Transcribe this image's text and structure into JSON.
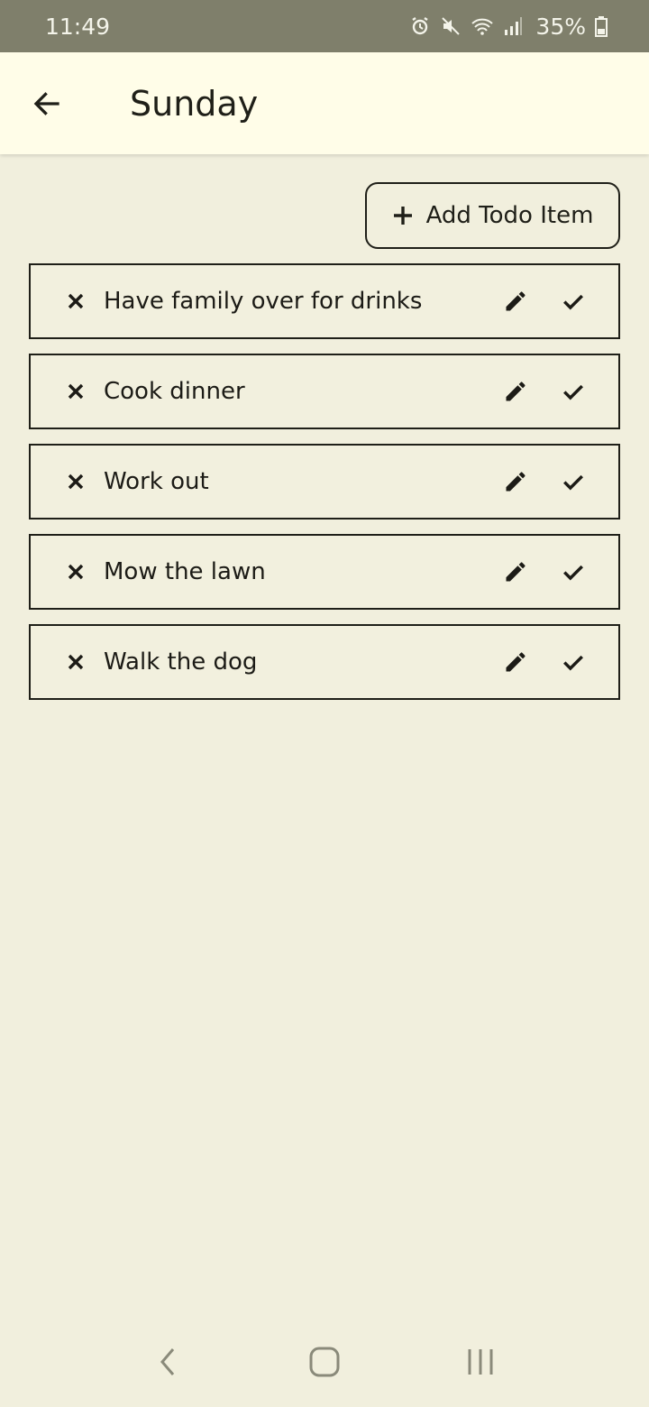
{
  "status_bar": {
    "time": "11:49",
    "battery": "35%",
    "icons": [
      "alarm-icon",
      "mute-icon",
      "wifi-icon",
      "signal-icon",
      "battery-icon"
    ]
  },
  "app_bar": {
    "title": "Sunday",
    "back_icon": "arrow-left-icon"
  },
  "add_button": {
    "label": "Add Todo Item",
    "icon": "plus-icon"
  },
  "todos": [
    {
      "label": "Have family over for drinks"
    },
    {
      "label": "Cook dinner"
    },
    {
      "label": "Work out"
    },
    {
      "label": "Mow the lawn"
    },
    {
      "label": "Walk the dog"
    }
  ],
  "todo_actions": [
    "close-icon",
    "pencil-icon",
    "check-icon"
  ],
  "nav_bar": [
    "back-nav-icon",
    "home-nav-icon",
    "recents-nav-icon"
  ],
  "colors": {
    "background": "#f1efdd",
    "app_bar": "#fffde8",
    "status_bar": "#7f7f6b",
    "foreground": "#1c1b16"
  }
}
